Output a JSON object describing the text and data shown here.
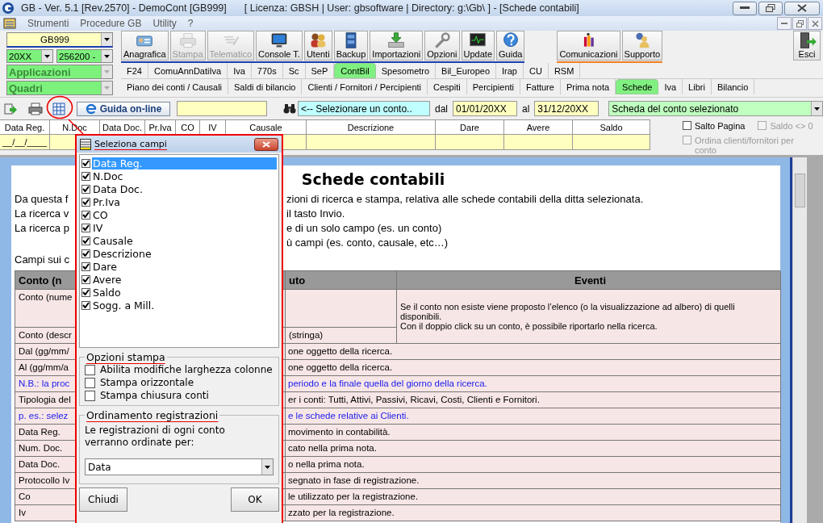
{
  "window": {
    "title": "GB - Ver. 5.1 [Rev.2570] -  DemoCont [GB999]",
    "info": "[ Licenza: GBSH | User: gbsoftware | Directory: g:\\Gb\\ ] - [Schede contabili]"
  },
  "menu": [
    "Strumenti",
    "Procedure GB",
    "Utility",
    "?"
  ],
  "selectors": {
    "company": "GB999",
    "year": "20XX",
    "account": "256200 -",
    "applications": "Applicazioni",
    "sections": "Quadri"
  },
  "toolbar": [
    {
      "label": "Anagrafica",
      "disabled": false
    },
    {
      "label": "Stampa",
      "disabled": true
    },
    {
      "label": "Telematico",
      "disabled": true
    },
    {
      "label": "Console T.",
      "disabled": false
    },
    {
      "label": "Utenti",
      "disabled": false
    },
    {
      "label": "Backup",
      "disabled": false
    },
    {
      "label": "Importazioni",
      "disabled": false
    },
    {
      "label": "Opzioni",
      "disabled": false
    },
    {
      "label": "Update",
      "disabled": false
    },
    {
      "label": "Guida",
      "disabled": false
    }
  ],
  "toolbar_extra": [
    {
      "label": "Comunicazioni",
      "disabled": false
    },
    {
      "label": "Supporto",
      "disabled": false
    }
  ],
  "exit": "Esci",
  "modules": [
    {
      "label": "F24",
      "selected": false
    },
    {
      "label": "ComuAnnDatiIva",
      "selected": false
    },
    {
      "label": "Iva",
      "selected": false
    },
    {
      "label": "770s",
      "selected": false
    },
    {
      "label": "Sc",
      "selected": false
    },
    {
      "label": "SeP",
      "selected": false
    },
    {
      "label": "ContBil",
      "selected": true
    },
    {
      "label": "Spesometro",
      "selected": false
    },
    {
      "label": "Bil_Europeo",
      "selected": false
    },
    {
      "label": "Irap",
      "selected": false
    },
    {
      "label": "CU",
      "selected": false
    },
    {
      "label": "RSM",
      "selected": false
    }
  ],
  "sections": [
    {
      "label": "Piano dei conti / Causali",
      "selected": false
    },
    {
      "label": "Saldi di bilancio",
      "selected": false
    },
    {
      "label": "Clienti / Fornitori / Percipienti",
      "selected": false
    },
    {
      "label": "Cespiti",
      "selected": false
    },
    {
      "label": "Percipienti",
      "selected": false
    },
    {
      "label": "Fatture",
      "selected": false
    },
    {
      "label": "Prima nota",
      "selected": false
    },
    {
      "label": "Schede",
      "selected": true
    },
    {
      "label": "Iva",
      "selected": false
    },
    {
      "label": "Libri",
      "selected": false
    },
    {
      "label": "Bilancio",
      "selected": false
    }
  ],
  "search": {
    "guide": "Guida on-line",
    "account_hint": "<-- Selezionare un conto..",
    "from_label": "dal",
    "from": "01/01/20XX",
    "to_label": "al",
    "to": "31/12/20XX",
    "report": "Scheda del conto selezionato"
  },
  "grid": {
    "columns": [
      "Data Reg.",
      "N.Doc",
      "Data Doc.",
      "Pr.Iva",
      "CO",
      "IV",
      "Causale",
      "Descrizione",
      "Dare",
      "Avere",
      "Saldo"
    ],
    "date_mask": "__/__/____"
  },
  "options": [
    {
      "label": "Salto Pagina",
      "checked": false,
      "disabled": false
    },
    {
      "label": "Saldo <> 0",
      "checked": false,
      "disabled": true
    },
    {
      "label": "Ordina clienti/fornitori per conto",
      "checked": false,
      "disabled": true
    }
  ],
  "document": {
    "title": "Schede contabili",
    "intro": [
      {
        "left": "Da questa f",
        "right": "zioni di ricerca e stampa, relativa alle schede contabili della ditta selezionata."
      },
      {
        "left": "La ricerca v",
        "right": "il tasto Invio."
      },
      {
        "left": "La ricerca p",
        "right": "e di un solo campo (es. un conto)"
      },
      {
        "right": "ù campi (es. conto, causale, etc…)"
      }
    ],
    "fields_intro": "Campi sui c",
    "table": {
      "headers": [
        "Conto (n",
        "uto",
        "Eventi"
      ],
      "account_rows": [
        {
          "field": "Conto (nume"
        },
        {
          "field": "Conto (descr",
          "content": "(stringa)"
        }
      ],
      "events": [
        "Se il conto non esiste viene proposto l’elenco (o la visualizzazione ad albero) di quelli disponibili.",
        "Con il doppio  click su un conto, è possibile riportarlo nella ricerca."
      ],
      "rows": [
        {
          "field": "Dal (gg/mm/",
          "text": "one oggetto della ricerca.",
          "kind": "normal"
        },
        {
          "field": "Al (gg/mm/a",
          "text": "one oggetto della ricerca.",
          "kind": "normal"
        },
        {
          "field": "N.B.: la proc",
          "text": "periodo e la finale quella del giorno della ricerca.",
          "kind": "note"
        },
        {
          "field": "Tipologia del",
          "text": "er i conti: Tutti, Attivi, Passivi, Ricavi, Costi, Clienti e Fornitori.",
          "kind": "normal"
        },
        {
          "field": "p. es.:  selez",
          "text": "e le schede relative ai Clienti.",
          "kind": "note"
        },
        {
          "field": "Data Reg.",
          "text": "movimento in contabilità.",
          "kind": "normal"
        },
        {
          "field": "Num. Doc.",
          "text": "cato nella prima nota.",
          "kind": "normal"
        },
        {
          "field": "Data Doc.",
          "text": "o nella prima nota.",
          "kind": "normal"
        },
        {
          "field": "Protocollo Iv",
          "text": "segnato in fase di registrazione.",
          "kind": "normal"
        },
        {
          "field": "Co",
          "text": "le utilizzato per la registrazione.",
          "kind": "normal"
        },
        {
          "field": "Iv",
          "text": "zzato per la registrazione.",
          "kind": "normal"
        }
      ]
    }
  },
  "dialog": {
    "title": "Seleziona campi",
    "fields": [
      {
        "label": "Data Reg.",
        "checked": true,
        "selected": true
      },
      {
        "label": "N.Doc",
        "checked": true,
        "selected": false
      },
      {
        "label": "Data Doc.",
        "checked": true,
        "selected": false
      },
      {
        "label": "Pr.Iva",
        "checked": true,
        "selected": false
      },
      {
        "label": "CO",
        "checked": true,
        "selected": false
      },
      {
        "label": "IV",
        "checked": true,
        "selected": false
      },
      {
        "label": "Causale",
        "checked": true,
        "selected": false
      },
      {
        "label": "Descrizione",
        "checked": true,
        "selected": false
      },
      {
        "label": "Dare",
        "checked": true,
        "selected": false
      },
      {
        "label": "Avere",
        "checked": true,
        "selected": false
      },
      {
        "label": "Saldo",
        "checked": true,
        "selected": false
      },
      {
        "label": "Sogg. a Mill.",
        "checked": true,
        "selected": false
      }
    ],
    "print_group": "Opzioni stampa",
    "print_options": [
      {
        "label": "Abilita modifiche larghezza colonne",
        "checked": false
      },
      {
        "label": "Stampa orizzontale",
        "checked": false
      },
      {
        "label": "Stampa chiusura conti",
        "checked": false
      }
    ],
    "order_group": "Ordinamento registrazioni",
    "order_text": "Le registrazioni di ogni conto verranno ordinate per:",
    "order_value": "Data",
    "buttons": [
      "Chiudi",
      "OK"
    ]
  }
}
